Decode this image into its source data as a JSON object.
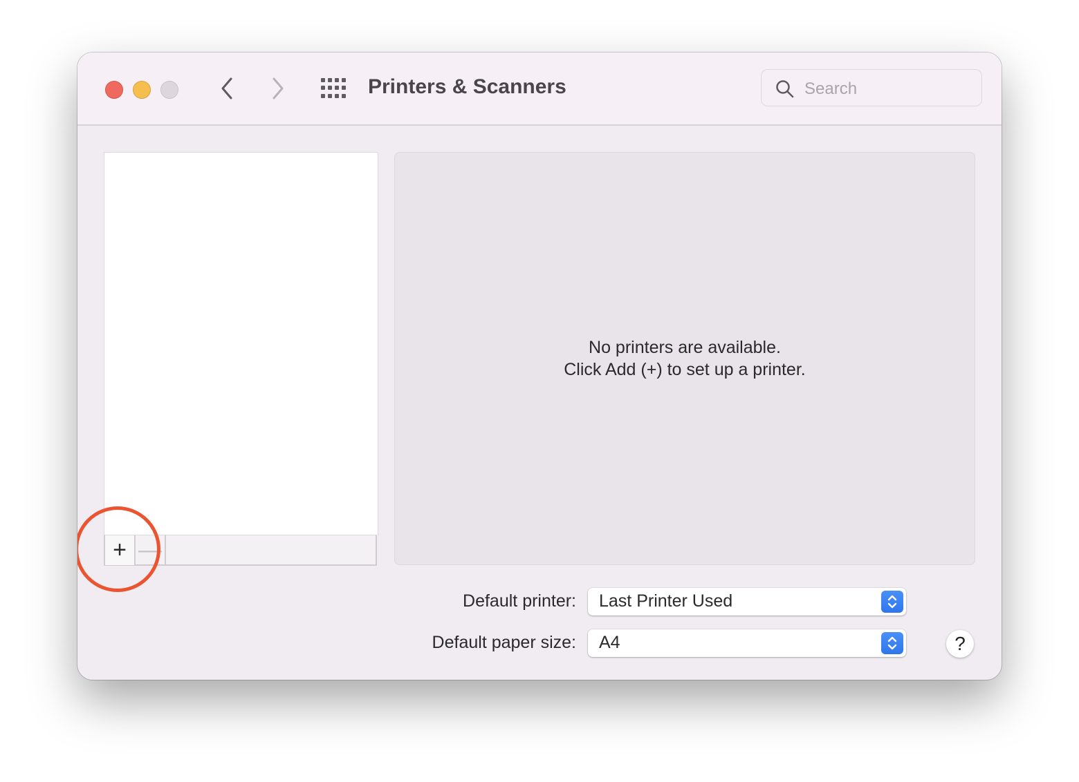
{
  "window": {
    "title": "Printers & Scanners",
    "search": {
      "placeholder": "Search",
      "value": ""
    }
  },
  "printer_list": {
    "items": [],
    "add_label": "+",
    "remove_label": "—"
  },
  "detail": {
    "empty_line1": "No printers are available.",
    "empty_line2": "Click Add (+) to set up a printer."
  },
  "settings": {
    "default_printer": {
      "label": "Default printer:",
      "value": "Last Printer Used"
    },
    "default_paper_size": {
      "label": "Default paper size:",
      "value": "A4"
    }
  },
  "help_label": "?",
  "colors": {
    "accent": "#3a82f2",
    "annotation_circle": "#ea5430",
    "close": "#ee6a5f",
    "minimize": "#f5be4f"
  }
}
